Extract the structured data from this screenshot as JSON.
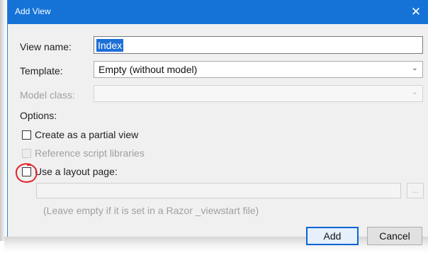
{
  "window": {
    "title": "Add View",
    "close_glyph": "✕"
  },
  "form": {
    "view_name_label": "View name:",
    "view_name_value": "Index",
    "template_label": "Template:",
    "template_value": "Empty (without model)",
    "model_class_label": "Model class:",
    "model_class_value": "",
    "options_label": "Options:",
    "create_partial_label": "Create as a partial view",
    "create_partial_checked": false,
    "reference_scripts_label": "Reference script libraries",
    "reference_scripts_checked": false,
    "use_layout_label": "Use a layout page:",
    "use_layout_checked": false,
    "layout_path_value": "",
    "browse_label": "...",
    "hint_text": "(Leave empty if it is set in a Razor _viewstart file)"
  },
  "buttons": {
    "add_label": "Add",
    "cancel_label": "Cancel"
  },
  "colors": {
    "titlebar": "#1573d8",
    "selection": "#1e6fd6",
    "annotation": "#e0242b"
  },
  "icons": {
    "dropdown": "chevron-down-icon",
    "close": "close-icon"
  }
}
